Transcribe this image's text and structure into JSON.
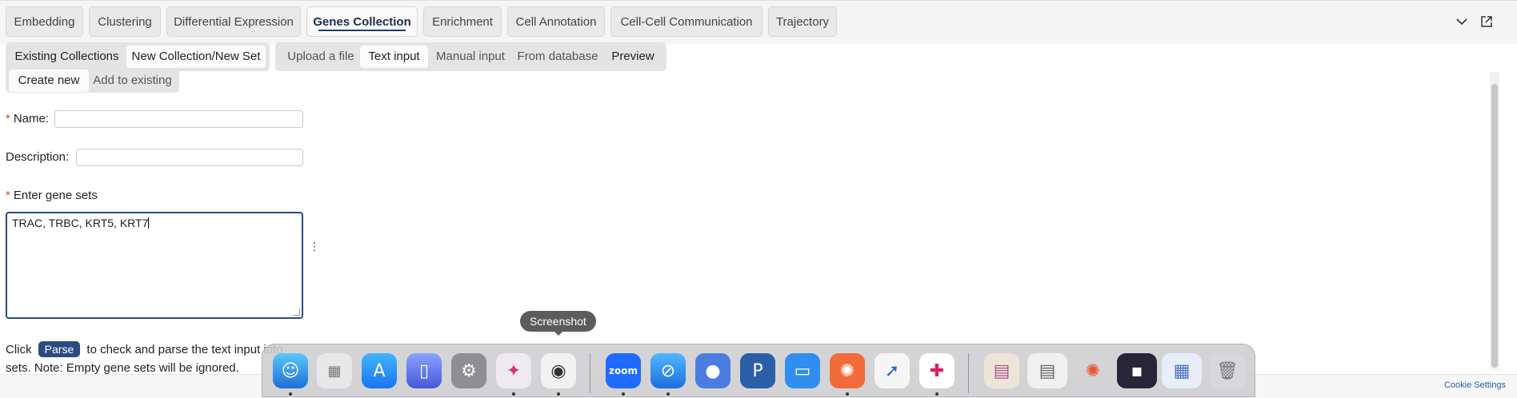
{
  "tabs": [
    {
      "label": "Embedding",
      "active": false
    },
    {
      "label": "Clustering",
      "active": false
    },
    {
      "label": "Differential Expression",
      "active": false
    },
    {
      "label": "Genes Collection",
      "active": true
    },
    {
      "label": "Enrichment",
      "active": false
    },
    {
      "label": "Cell Annotation",
      "active": false
    },
    {
      "label": "Cell-Cell Communication",
      "active": false
    },
    {
      "label": "Trajectory",
      "active": false
    }
  ],
  "collection_mode": {
    "existing": "Existing Collections",
    "new": "New Collection/New Set",
    "selected": "New Collection/New Set"
  },
  "input_mode": {
    "upload": "Upload a file",
    "text": "Text input",
    "manual": "Manual input",
    "database": "From database",
    "preview": "Preview",
    "selected": "Text input"
  },
  "create_mode": {
    "create": "Create new",
    "add": "Add to existing",
    "selected": "Create new"
  },
  "form": {
    "name_label": "Name",
    "name_value": "",
    "description_label": "Description",
    "description_value": "",
    "genes_label": "Enter gene sets",
    "genes_value": "TRAC, TRBC, KRT5, KRT7",
    "required_marker": "*",
    "colon": ":"
  },
  "parse_hint": {
    "before": "Click",
    "button": "Parse",
    "after": "to check and parse the text input into",
    "note": "sets. Note: Empty gene sets will be ignored."
  },
  "footer": {
    "cookie_settings": "Cookie Settings"
  },
  "dock": {
    "tooltip": "Screenshot",
    "apps": [
      "finder",
      "launchpad",
      "app-store",
      "simulator",
      "system-settings",
      "affinity",
      "screenshot",
      "zoom",
      "safari",
      "webcam",
      "pockity",
      "keynote",
      "perplexity",
      "navigator",
      "slack"
    ],
    "zoom_label": "zoom"
  },
  "colors": {
    "accent": "#2b4a80",
    "required": "#e0412c",
    "tab_underline": "#1d3c6e"
  }
}
